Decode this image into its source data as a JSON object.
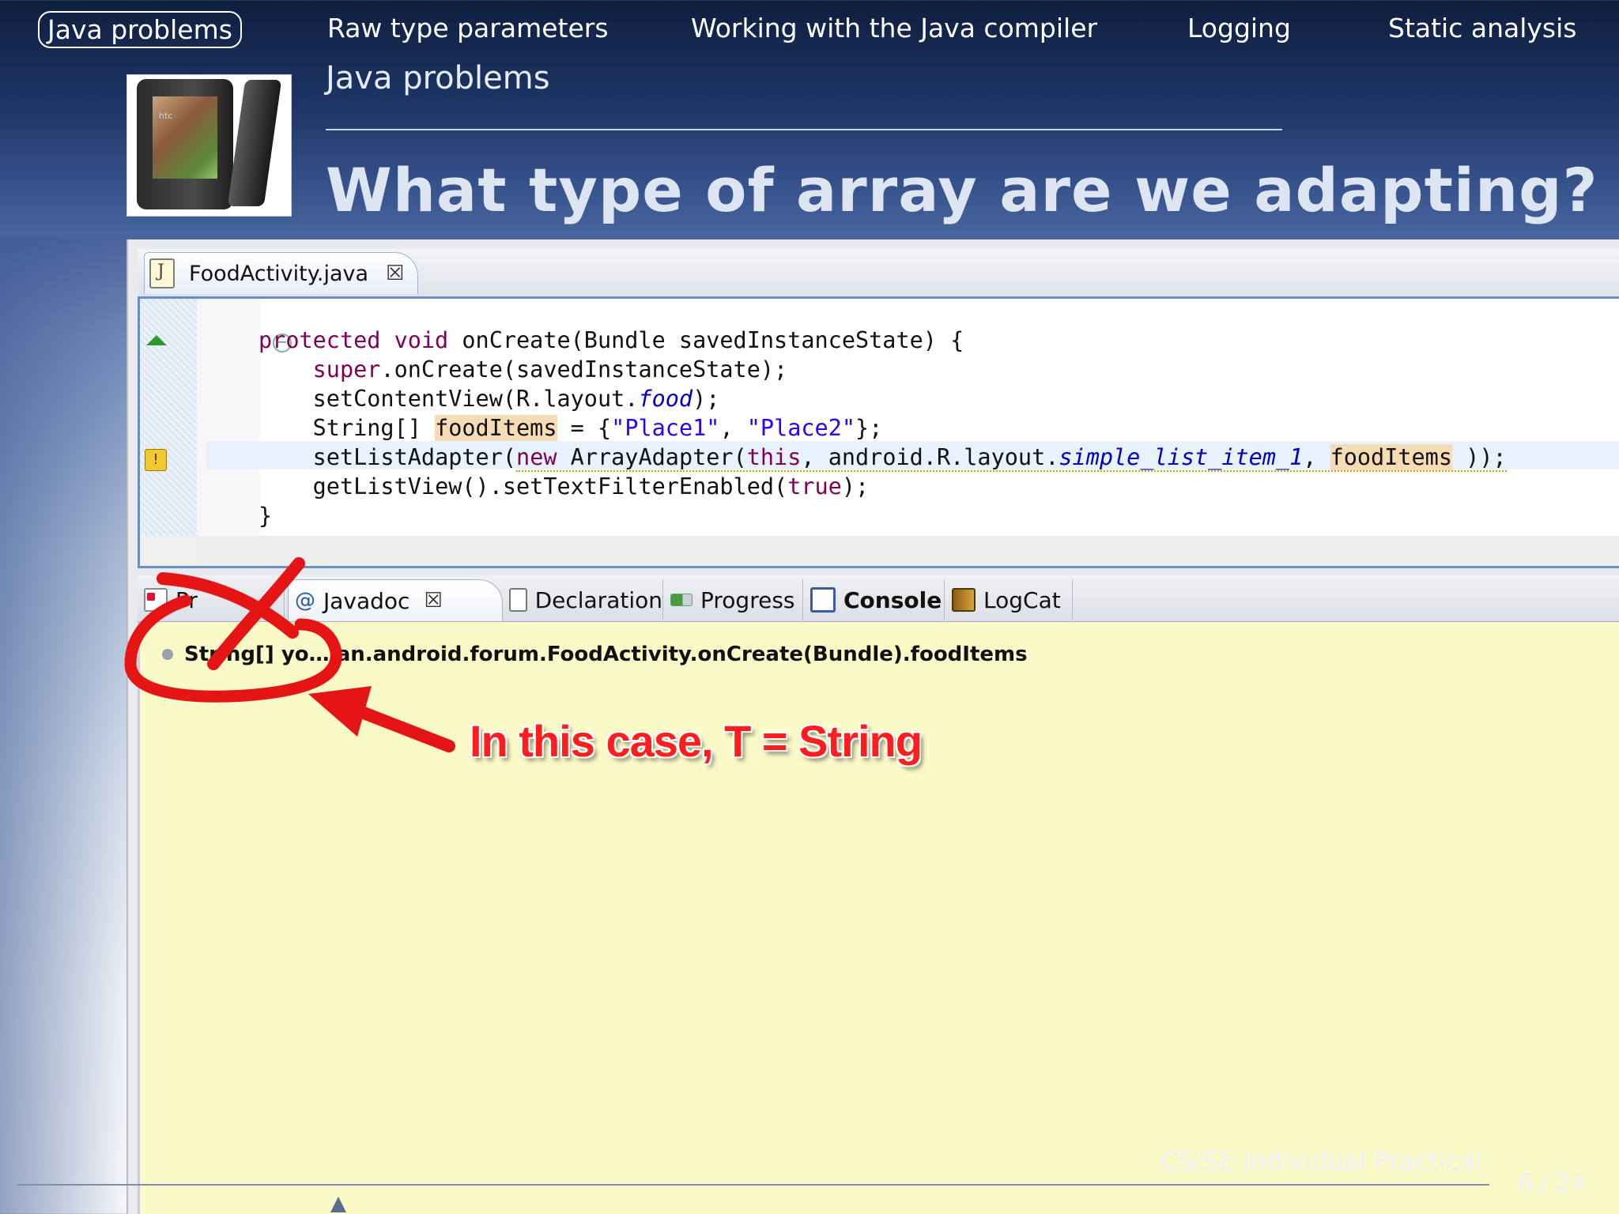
{
  "nav": {
    "items": [
      {
        "label": "Java problems",
        "active": true
      },
      {
        "label": "Raw type parameters",
        "active": false
      },
      {
        "label": "Working with the Java compiler",
        "active": false
      },
      {
        "label": "Logging",
        "active": false
      },
      {
        "label": "Static analysis",
        "active": false
      }
    ]
  },
  "header": {
    "section": "Java problems",
    "title": "What type of array are we adapting?"
  },
  "logo": {
    "brand": "htc"
  },
  "editor": {
    "tab": {
      "label": "FoodActivity.java",
      "close": "☒"
    },
    "code": [
      "protected void onCreate(Bundle savedInstanceState) {",
      "super.onCreate(savedInstanceState);",
      "setContentView(R.layout.food);",
      "String[] foodItems = {\"Place1\", \"Place2\"};",
      "setListAdapter(new ArrayAdapter(this, android.R.layout.simple_list_item_1, foodItems ));",
      "getListView().setTextFilterEnabled(true);",
      "}"
    ],
    "code_parts": {
      "l1_kw": "protected void",
      "l1_rest": " onCreate(Bundle savedInstanceState) {",
      "l2_kw": "super",
      "l2_rest": ".onCreate(savedInstanceState);",
      "l3_a": "setContentView(R.layout.",
      "l3_field": "food",
      "l3_b": ");",
      "l4_a": "String[] ",
      "l4_var": "foodItems",
      "l4_b": " = {",
      "l4_s1": "\"Place1\"",
      "l4_c": ", ",
      "l4_s2": "\"Place2\"",
      "l4_d": "};",
      "l5_a": "setListAdapter(",
      "l5_new": "new",
      "l5_b": " ArrayAdapter(",
      "l5_this": "this",
      "l5_c": ", android.R.layout.",
      "l5_field": "simple_list_item_1",
      "l5_d": ", ",
      "l5_var": "foodItems",
      "l5_e": " ));",
      "l6_a": "getListView().setTextFilterEnabled(",
      "l6_true": "true",
      "l6_b": ");",
      "l7": "}"
    }
  },
  "views": {
    "tabs": [
      {
        "label": "Pr",
        "icon": "problems-icon"
      },
      {
        "label": "Javadoc",
        "icon": "at-icon",
        "close": "☒"
      },
      {
        "label": "Declaration",
        "icon": "declaration-icon"
      },
      {
        "label": "Progress",
        "icon": "progress-icon"
      },
      {
        "label": "Console",
        "icon": "console-icon"
      },
      {
        "label": "LogCat",
        "icon": "logcat-icon"
      }
    ],
    "javadoc_text": "String[] yo… an.android.forum.FoodActivity.onCreate(Bundle).foodItems"
  },
  "annotation": {
    "text": "In this case, T = String",
    "color": "#ff1e1e"
  },
  "footer": {
    "title": "CS/SE Individual Practical",
    "page": "6 / 24"
  }
}
